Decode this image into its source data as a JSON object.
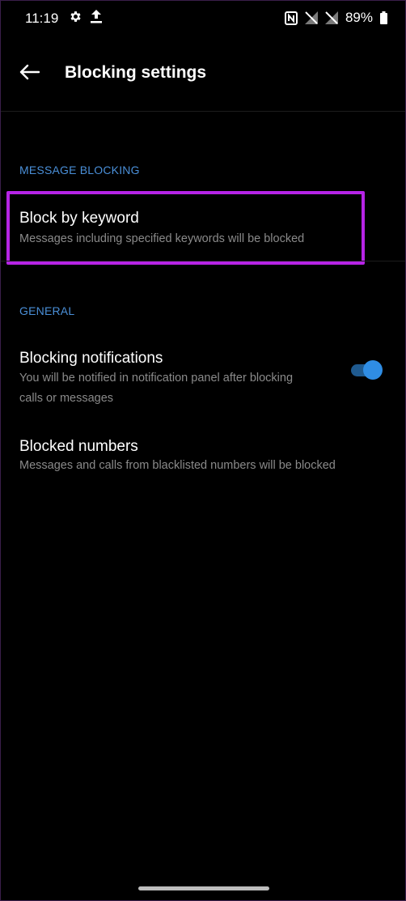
{
  "status_bar": {
    "time": "11:19",
    "battery": "89%",
    "icons": [
      "settings-gear-icon",
      "upload-icon",
      "nfc-icon",
      "no-signal-icon",
      "no-signal-icon",
      "battery-icon"
    ]
  },
  "app_bar": {
    "title": "Blocking settings",
    "back_icon": "arrow-left-icon"
  },
  "sections": {
    "message_blocking": {
      "header": "MESSAGE BLOCKING",
      "items": [
        {
          "title": "Block by keyword",
          "summary": "Messages including specified keywords will be blocked"
        }
      ]
    },
    "general": {
      "header": "GENERAL",
      "items": [
        {
          "title": "Blocking notifications",
          "summary_line1": "You will be notified in notification panel after blocking",
          "summary_line2": "calls or messages",
          "toggle_on": true
        },
        {
          "title": "Blocked numbers",
          "summary": "Messages and calls from blacklisted numbers will be blocked"
        }
      ]
    }
  },
  "colors": {
    "background": "#000000",
    "accent": "#2f8de4",
    "section_header": "#4a8fd8",
    "summary_text": "#8a8a8a",
    "highlight": "#b624e6"
  }
}
